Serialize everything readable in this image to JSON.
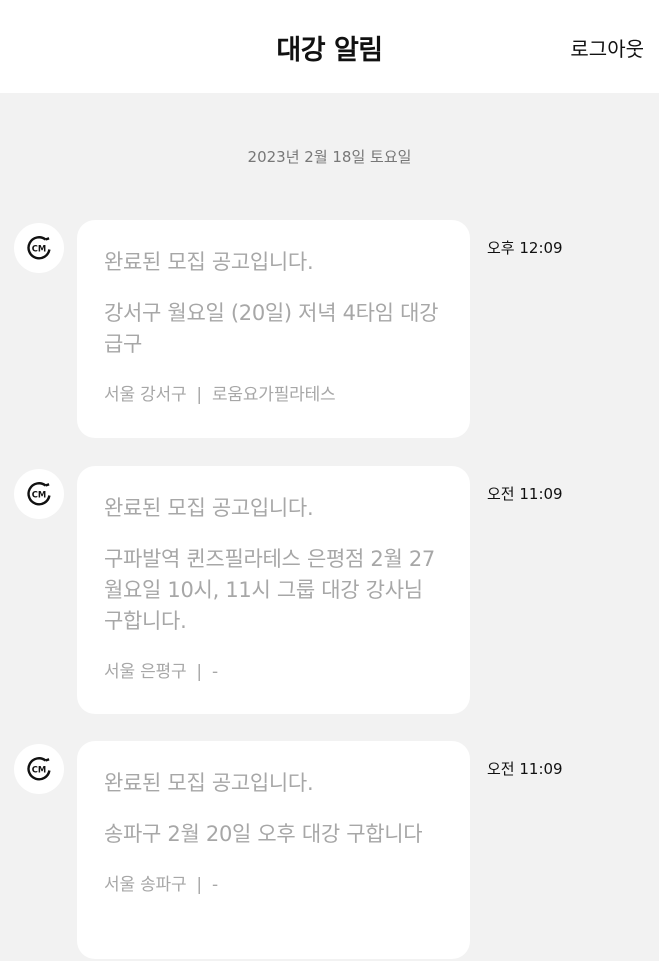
{
  "header": {
    "title": "대강 알림",
    "logout_label": "로그아웃"
  },
  "date_separator": "2023년 2월 18일 토요일",
  "messages": [
    {
      "avatar_text": "CM",
      "status": "완료된 모집 공고입니다.",
      "body": "강서구 월요일 (20일) 저녁 4타임 대강 급구",
      "region": "서울 강서구",
      "separator": "|",
      "studio": "로움요가필라테스",
      "time": "오후 12:09"
    },
    {
      "avatar_text": "CM",
      "status": "완료된 모집 공고입니다.",
      "body": "구파발역 퀸즈필라테스 은평점 2월 27 월요일 10시, 11시 그룹 대강 강사님 구합니다.",
      "region": "서울 은평구",
      "separator": "|",
      "studio": "-",
      "time": "오전 11:09"
    },
    {
      "avatar_text": "CM",
      "status": "완료된 모집 공고입니다.",
      "body": "송파구 2월 20일 오후 대강 구합니다",
      "region": "서울 송파구",
      "separator": "|",
      "studio": "-",
      "time": "오전 11:09"
    }
  ],
  "colors": {
    "background": "#f2f2f2",
    "bubble": "#ffffff",
    "muted_text": "#a7a7a7",
    "primary_text": "#111111"
  }
}
